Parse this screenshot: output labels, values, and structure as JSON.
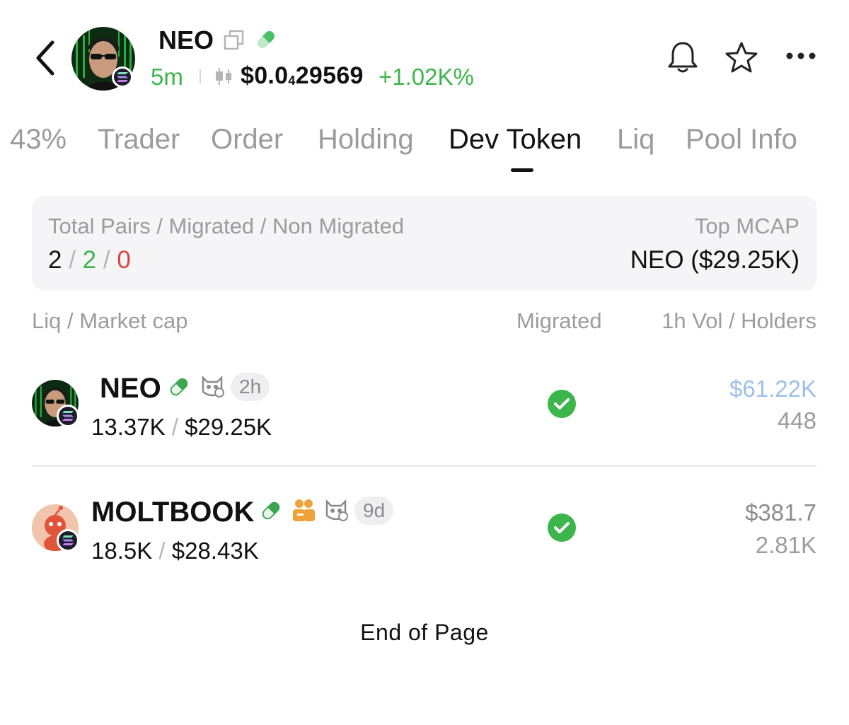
{
  "header": {
    "token_name": "NEO",
    "age": "5m",
    "price_prefix": "$0.0",
    "price_zeros": "4",
    "price_digits": "29569",
    "change": "+1.02K%",
    "icons": [
      "back-icon",
      "copy-icon",
      "pill-icon",
      "candlestick-icon",
      "bell-icon",
      "star-icon",
      "more-icon"
    ]
  },
  "tabs": [
    {
      "label": "43%"
    },
    {
      "label": "Trader"
    },
    {
      "label": "Order"
    },
    {
      "label": "Holding"
    },
    {
      "label": "Dev Token",
      "active": true
    },
    {
      "label": "Liq"
    },
    {
      "label": "Pool Info"
    }
  ],
  "summary": {
    "label": "Total Pairs / Migrated / Non Migrated",
    "total": "2",
    "migrated": "2",
    "non_migrated": "0",
    "sep": "/",
    "top_label": "Top MCAP",
    "top_value": "NEO ($29.25K)"
  },
  "columns": {
    "liq_mcap": "Liq / Market cap",
    "migrated": "Migrated",
    "vol_holders": "1h Vol / Holders"
  },
  "rows": [
    {
      "name": "NEO",
      "age": "2h",
      "liq": "13.37K",
      "mcap": "$29.25K",
      "sep": "/",
      "vol": "$61.22K",
      "holders": "448",
      "vol_color": "#9cc0ea"
    },
    {
      "name": "MOLTBOOK",
      "age": "9d",
      "liq": "18.5K",
      "mcap": "$28.43K",
      "sep": "/",
      "vol": "$381.7",
      "holders": "2.81K",
      "vol_color": "#8c8c8c"
    }
  ],
  "footer": "End of Page",
  "colors": {
    "green": "#3cb54a",
    "red": "#d9443f",
    "blue_vol": "#9cc0ea"
  }
}
